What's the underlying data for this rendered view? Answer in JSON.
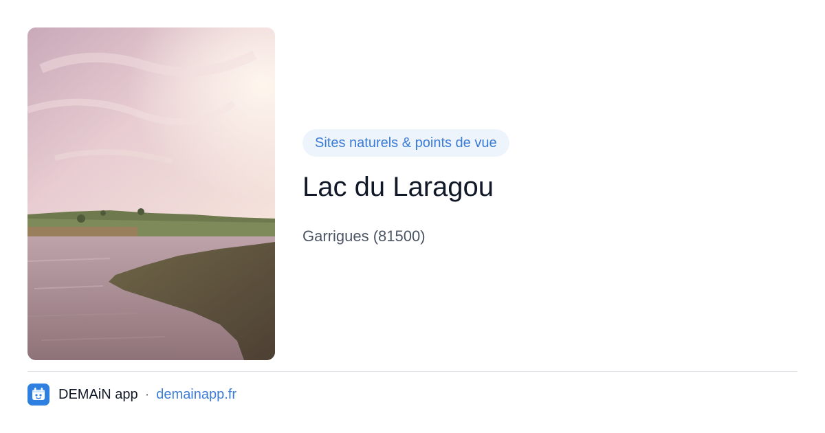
{
  "card": {
    "category_badge": "Sites naturels & points de vue",
    "title": "Lac du Laragou",
    "location": "Garrigues (81500)",
    "image_description_icon": "landscape-photo"
  },
  "footer": {
    "app_name": "DEMAiN app",
    "separator": "·",
    "domain": "demainapp.fr",
    "app_icon": "demain-app-icon"
  },
  "colors": {
    "accent": "#3a7bd5",
    "badge_bg": "#eef4fc",
    "title": "#111827",
    "muted": "#4b5563",
    "app_icon_bg": "#2f7fe0"
  }
}
